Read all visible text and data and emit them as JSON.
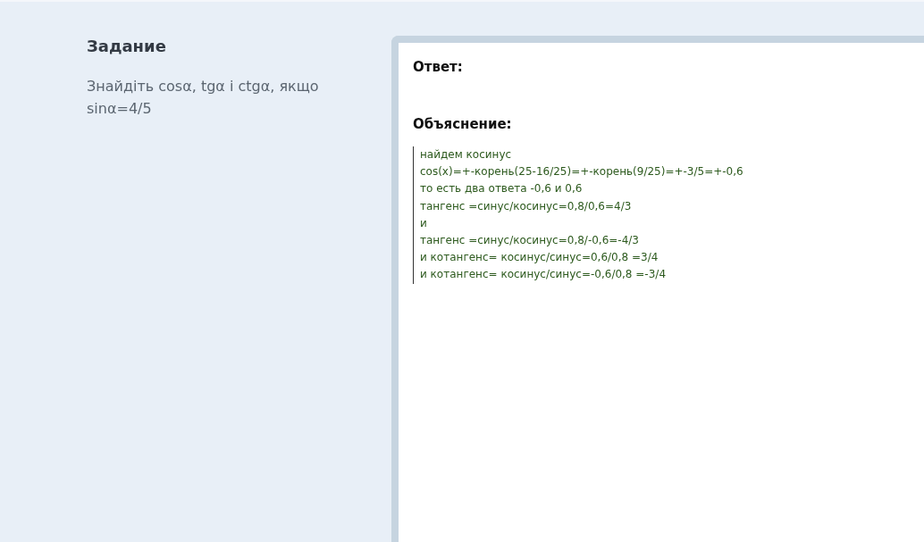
{
  "task": {
    "title": "Задание",
    "text": "Знайдіть cosα, tgα і ctgα, якщо sinα=4/5"
  },
  "answer": {
    "label": "Ответ:"
  },
  "explanation": {
    "label": "Объяснение:",
    "lines": [
      "найдем косинус",
      "cos(x)=+-корень(25-16/25)=+-корень(9/25)=+-3/5=+-0,6",
      "то есть два ответа -0,6 и 0,6",
      "тангенс =синус/косинус=0,8/0,6=4/3",
      "и",
      "тангенс =синус/косинус=0,8/-0,6=-4/3",
      "и котангенс= косинус/синус=0,6/0,8 =3/4",
      "и котангенс= косинус/синус=-0,6/0,8 =-3/4"
    ]
  }
}
